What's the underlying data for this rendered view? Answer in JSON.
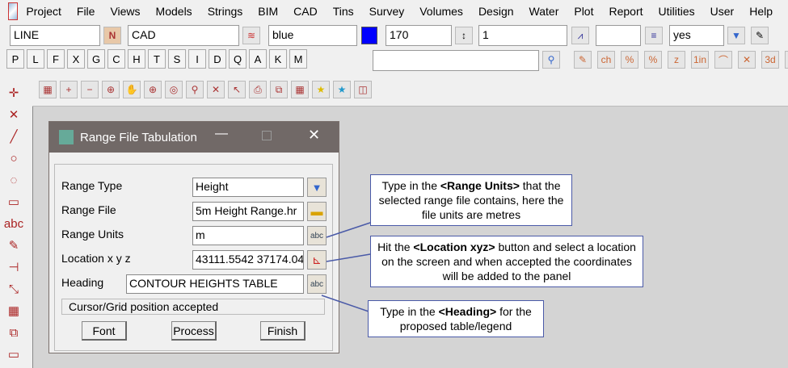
{
  "menu": [
    "Project",
    "File",
    "Views",
    "Models",
    "Strings",
    "BIM",
    "CAD",
    "Tins",
    "Survey",
    "Volumes",
    "Design",
    "Water",
    "Plot",
    "Report",
    "Utilities",
    "User",
    "Help"
  ],
  "toolbar": {
    "string_name": "LINE",
    "model": "CAD",
    "colour": "blue",
    "colour_swatch": "#0000ff",
    "height": "170",
    "weight": "1",
    "style": "",
    "visible": "yes",
    "search": ""
  },
  "letters": [
    "P",
    "L",
    "F",
    "X",
    "G",
    "C",
    "H",
    "T",
    "S",
    "I",
    "D",
    "Q",
    "A",
    "K",
    "M"
  ],
  "dialog": {
    "title": "Range File Tabulation",
    "fields": [
      {
        "label": "Range Type",
        "value": "Height",
        "button": "dropdown"
      },
      {
        "label": "Range File",
        "value": "5m Height Range.hr",
        "button": "folder"
      },
      {
        "label": "Range Units",
        "value": "m",
        "button": "abc"
      },
      {
        "label": "Location x y z",
        "value": "43111.5542 37174.04",
        "button": "pick"
      },
      {
        "label": "Heading",
        "value": "CONTOUR HEIGHTS TABLE",
        "button": "abc"
      }
    ],
    "status": "Cursor/Grid position accepted",
    "buttons": {
      "font": "Font",
      "process": "Process",
      "finish": "Finish"
    }
  },
  "callouts": [
    {
      "pre": "Type in the ",
      "bold": "<Range Units>",
      "post": " that the selected range file contains, here the file units are metres"
    },
    {
      "pre": "Hit the ",
      "bold": "<Location xyz>",
      "post": " button and select a location on the screen and when accepted the coordinates will be added to the panel"
    },
    {
      "pre": "Type in the ",
      "bold": "<Heading>",
      "post": " for the proposed table/legend"
    }
  ],
  "annotation_color": "#4a5aa8"
}
